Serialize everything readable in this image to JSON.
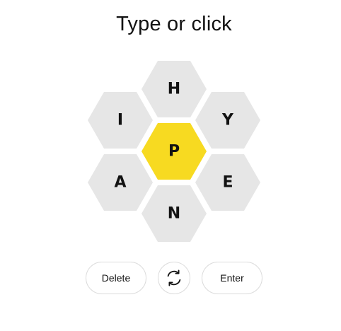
{
  "header": {
    "prompt": "Type or click"
  },
  "hive": {
    "center_letter": "P",
    "outer_letters": [
      "H",
      "Y",
      "E",
      "N",
      "A",
      "I"
    ],
    "colors": {
      "center": "#f7da21",
      "outer": "#e6e6e6",
      "letter": "#121212"
    }
  },
  "controls": {
    "delete_label": "Delete",
    "shuffle_icon": "shuffle-icon",
    "enter_label": "Enter"
  }
}
